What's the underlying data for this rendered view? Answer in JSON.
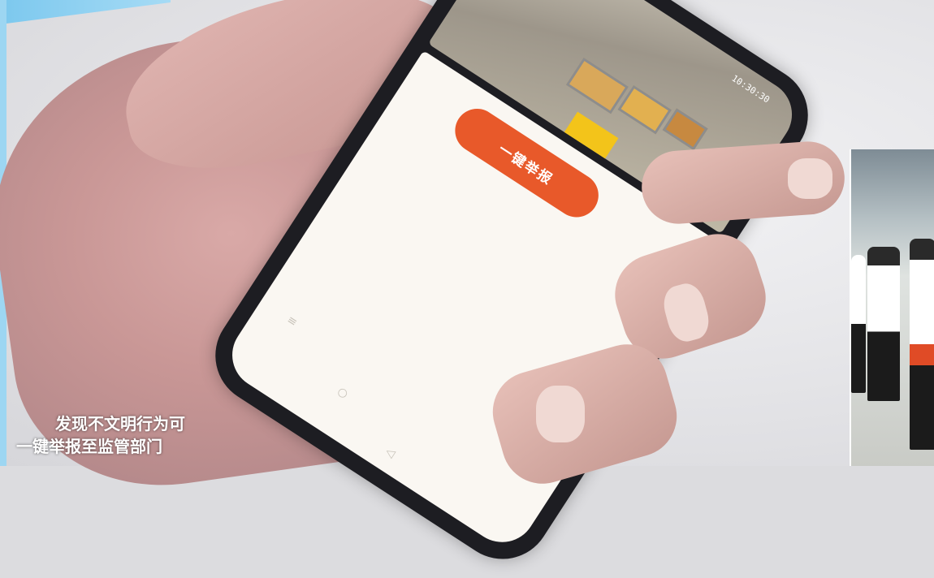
{
  "photo": {
    "phone_button_label": "一键举报",
    "camera_timestamp": "10:30:30",
    "caption_line1": "发现不文明行为可",
    "caption_line2": "一键举报至监管部门"
  },
  "colors": {
    "button": "#e8592a",
    "accent_bar": "#7cc8ee",
    "caption_text": "#ffffff"
  },
  "icons": [
    "menu-icon",
    "home-icon",
    "back-icon"
  ]
}
